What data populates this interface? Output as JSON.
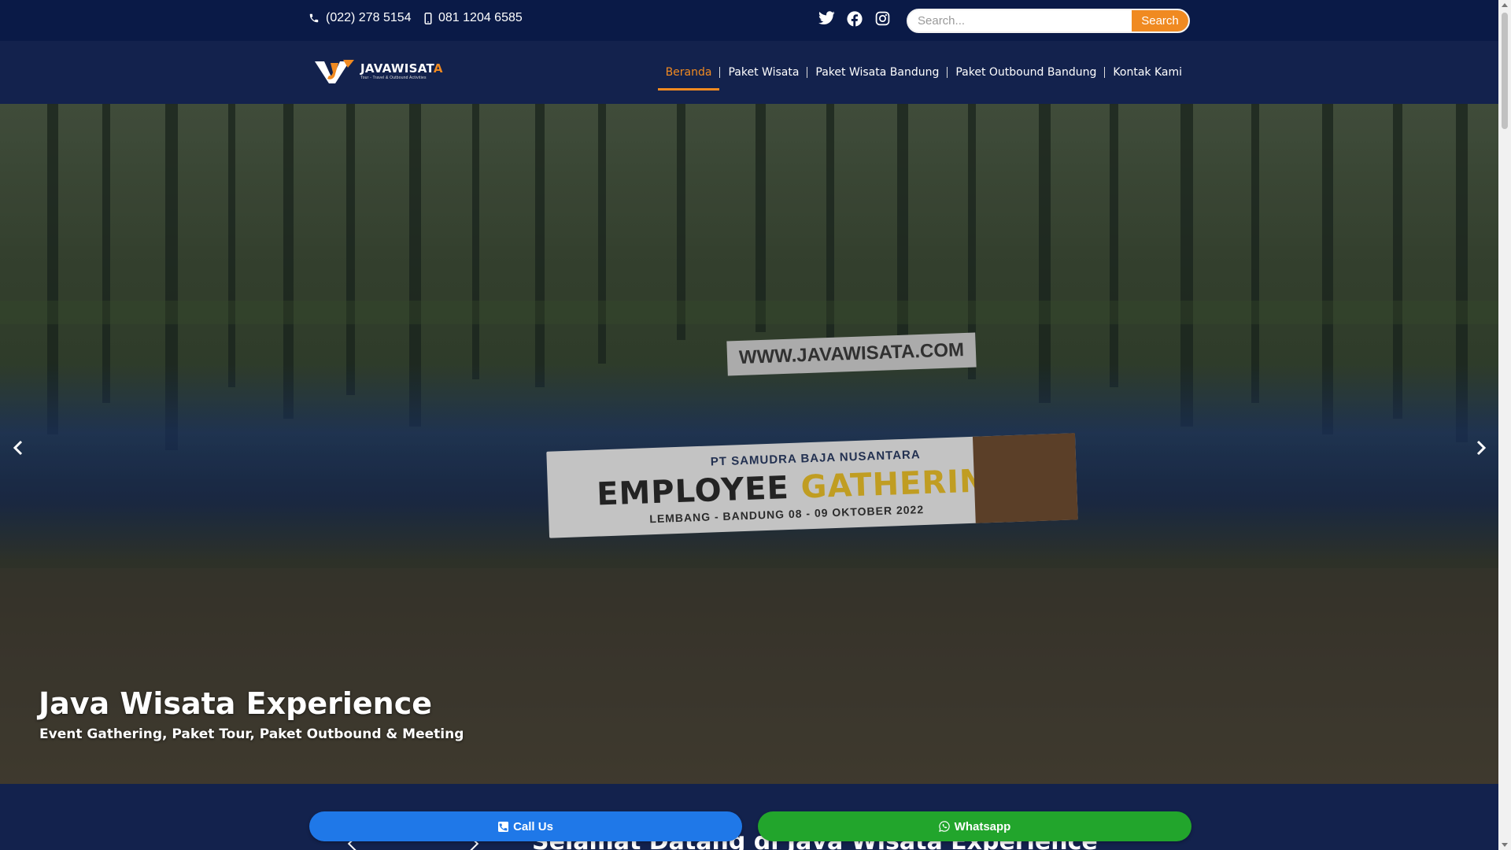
{
  "topbar": {
    "phone": "(022) 278 5154",
    "mobile": "081 1204 6585",
    "social": [
      {
        "name": "twitter-icon"
      },
      {
        "name": "facebook-icon"
      },
      {
        "name": "instagram-icon"
      }
    ],
    "search": {
      "placeholder": "Search...",
      "button": "Search"
    }
  },
  "logo": {
    "name_main": "JAVAWISAT",
    "name_accent": "A",
    "tagline": "Tour - Travel & Outbound Activities"
  },
  "nav": {
    "items": [
      {
        "label": "Beranda",
        "active": true
      },
      {
        "label": "Paket Wisata",
        "active": false
      },
      {
        "label": "Paket Wisata Bandung",
        "active": false
      },
      {
        "label": "Paket Outbound Bandung",
        "active": false
      },
      {
        "label": "Kontak Kami",
        "active": false
      }
    ]
  },
  "hero": {
    "banner_top": "WWW.JAVAWISATA.COM",
    "banner_org": "PT SAMUDRA BAJA NUSANTARA",
    "banner_event_a": "EMPLOYEE ",
    "banner_event_b": "GATHERING",
    "banner_location": "LEMBANG - BANDUNG     08 - 09 OKTOBER 2022",
    "title": "Java Wisata Experience",
    "subtitle": "Event Gathering, Paket Tour, Paket Outbound & Meeting"
  },
  "section": {
    "welcome": "Selamat Datang di Java Wisata Experience"
  },
  "cta": {
    "call": "Call Us",
    "whatsapp": "Whatsapp"
  },
  "colors": {
    "accent": "#f08a21",
    "navy": "#0a1a47",
    "call": "#1f78e8",
    "whatsapp": "#22a52c"
  }
}
